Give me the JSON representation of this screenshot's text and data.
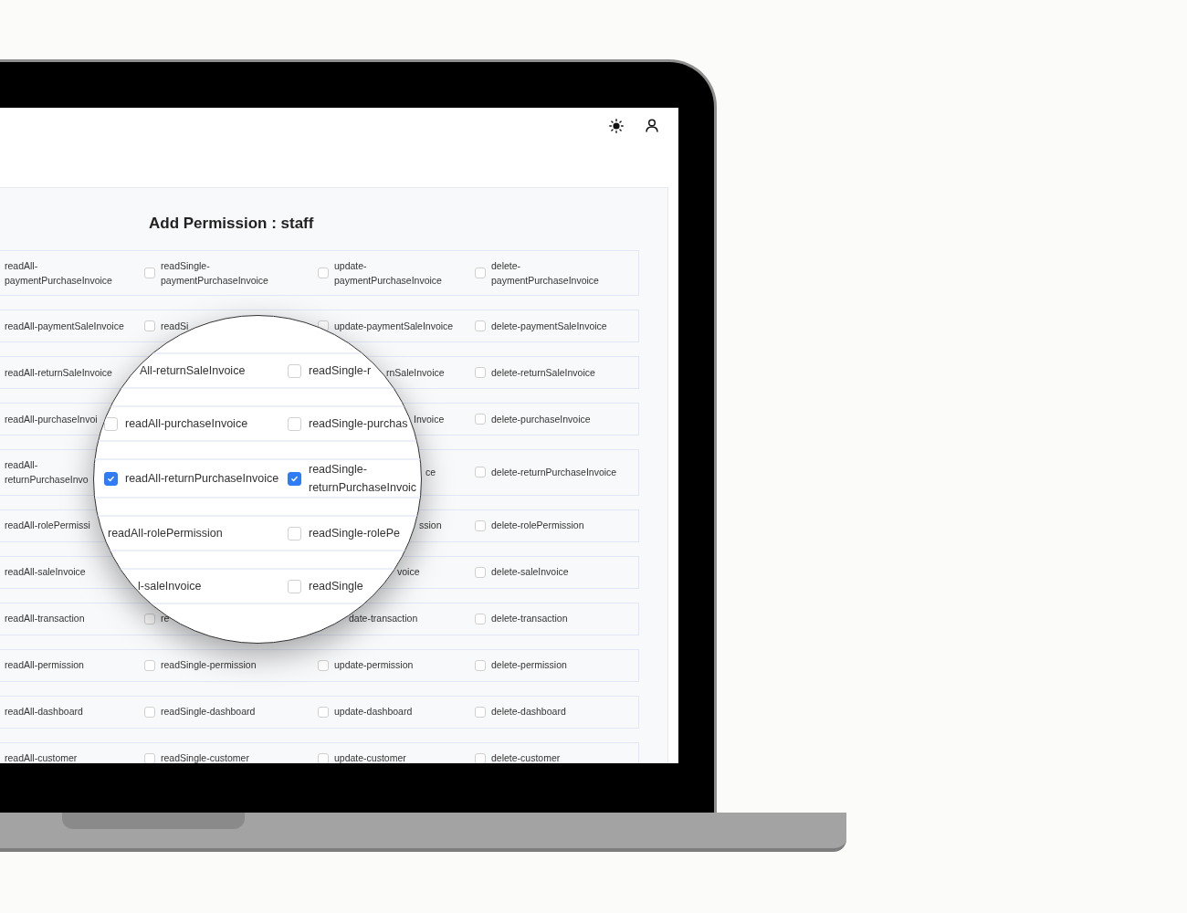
{
  "title": "Add Permission : staff",
  "rows": [
    {
      "cells": [
        {
          "text": "readAll-paymentPurchaseInvoice"
        },
        {
          "text": "readSingle-paymentPurchaseInvoice",
          "checked": false
        },
        {
          "text": "update-paymentPurchaseInvoice",
          "checked": false
        },
        {
          "text": "delete-paymentPurchaseInvoice",
          "checked": false
        }
      ]
    },
    {
      "cells": [
        {
          "text": "readAll-paymentSaleInvoice"
        },
        {
          "text": "readSi",
          "checked": false
        },
        {
          "text": "update-paymentSaleInvoice",
          "checked": false
        },
        {
          "text": "delete-paymentSaleInvoice",
          "checked": false
        }
      ]
    },
    {
      "cells": [
        {
          "text": "readAll-returnSaleInvoice"
        },
        {},
        {
          "text": "rnSaleInvoice"
        },
        {
          "text": "delete-returnSaleInvoice",
          "checked": false
        }
      ]
    },
    {
      "cells": [
        {
          "text": "readAll-purchaseInvoi"
        },
        {},
        {
          "text": "Invoice"
        },
        {
          "text": "delete-purchaseInvoice",
          "checked": false
        }
      ]
    },
    {
      "cells": [
        {
          "text": "readAll-returnPurchaseInvo"
        },
        {},
        {
          "text": "ce"
        },
        {
          "text": "delete-returnPurchaseInvoice",
          "checked": false
        }
      ]
    },
    {
      "cells": [
        {
          "text": "readAll-rolePermissi"
        },
        {},
        {
          "text": "ssion"
        },
        {
          "text": "delete-rolePermission",
          "checked": false
        }
      ]
    },
    {
      "cells": [
        {
          "text": "readAll-saleInvoice"
        },
        {},
        {
          "text": "voice"
        },
        {
          "text": "delete-saleInvoice",
          "checked": false
        }
      ]
    },
    {
      "cells": [
        {
          "text": "readAll-transaction"
        },
        {
          "text": "re",
          "checked": false
        },
        {
          "text": "date-transaction"
        },
        {
          "text": "delete-transaction",
          "checked": false
        }
      ]
    },
    {
      "cells": [
        {
          "text": "readAll-permission"
        },
        {
          "text": "readSingle-permission",
          "checked": false
        },
        {
          "text": "update-permission",
          "checked": false
        },
        {
          "text": "delete-permission",
          "checked": false
        }
      ]
    },
    {
      "cells": [
        {
          "text": "readAll-dashboard"
        },
        {
          "text": "readSingle-dashboard",
          "checked": false
        },
        {
          "text": "update-dashboard",
          "checked": false
        },
        {
          "text": "delete-dashboard",
          "checked": false
        }
      ]
    },
    {
      "cells": [
        {
          "text": "readAll-customer"
        },
        {
          "text": "readSingle-customer",
          "checked": false
        },
        {
          "text": "update-customer",
          "checked": false
        },
        {
          "text": "delete-customer",
          "checked": false
        }
      ]
    }
  ],
  "lens": {
    "rows": [
      {
        "cells": [
          {
            "text": "All-returnSaleInvoice"
          },
          {
            "text": "readSingle-r",
            "checked": false
          }
        ]
      },
      {
        "cells": [
          {
            "text": "readAll-purchaseInvoice",
            "checked": false
          },
          {
            "text": "readSingle-purchas",
            "checked": false
          }
        ]
      },
      {
        "cells": [
          {
            "text": "readAll-returnPurchaseInvoice",
            "checked": true
          },
          {
            "text": "readSingle-returnPurchaseInvoic",
            "checked": true
          }
        ]
      },
      {
        "cells": [
          {
            "text": "readAll-rolePermission"
          },
          {
            "text": "readSingle-rolePe",
            "checked": false
          }
        ]
      },
      {
        "cells": [
          {
            "text": "l-saleInvoice"
          },
          {
            "text": "readSingle",
            "checked": false
          }
        ]
      }
    ]
  }
}
